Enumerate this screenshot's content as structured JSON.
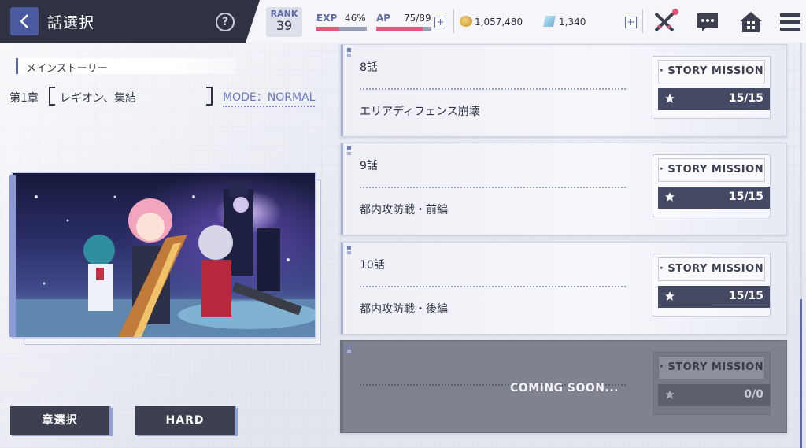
{
  "header": {
    "title": "話選択",
    "help_symbol": "?",
    "rank": {
      "label": "RANK",
      "value": "39"
    },
    "exp": {
      "label": "EXP",
      "value": "46%",
      "fill": 0.46
    },
    "ap": {
      "label": "AP",
      "value": "75/89",
      "fill": 0.843
    },
    "gold": "1,057,480",
    "gems": "1,340",
    "plus_symbol": "+",
    "icons": [
      "crossed-swords-icon",
      "chat-icon",
      "home-icon",
      "menu-icon"
    ]
  },
  "left_panel": {
    "section_title": "メインストーリー",
    "chapter_number": "第1章",
    "chapter_name": "レギオン、集結",
    "mode": "MODE：NORMAL",
    "buttons": {
      "chapter_select": "章選択",
      "hard": "HARD"
    }
  },
  "episodes": [
    {
      "number": "8話",
      "name": "エリアディフェンス崩壊",
      "mission_label": "· STORY MISSION ·",
      "score": "15/15",
      "locked": false
    },
    {
      "number": "9話",
      "name": "都内攻防戦・前編",
      "mission_label": "· STORY MISSION ·",
      "score": "15/15",
      "locked": false
    },
    {
      "number": "10話",
      "name": "都内攻防戦・後編",
      "mission_label": "· STORY MISSION ·",
      "score": "15/15",
      "locked": false
    },
    {
      "number": "",
      "name": "",
      "mission_label": "· STORY MISSION ·",
      "score": "0/0",
      "locked": true,
      "locked_text": "COMING SOON..."
    }
  ],
  "colors": {
    "accent": "#5d6aa8",
    "dark": "#2f3242",
    "bar_fill": "#e8547a",
    "mission_score_bg": "#454a64"
  }
}
